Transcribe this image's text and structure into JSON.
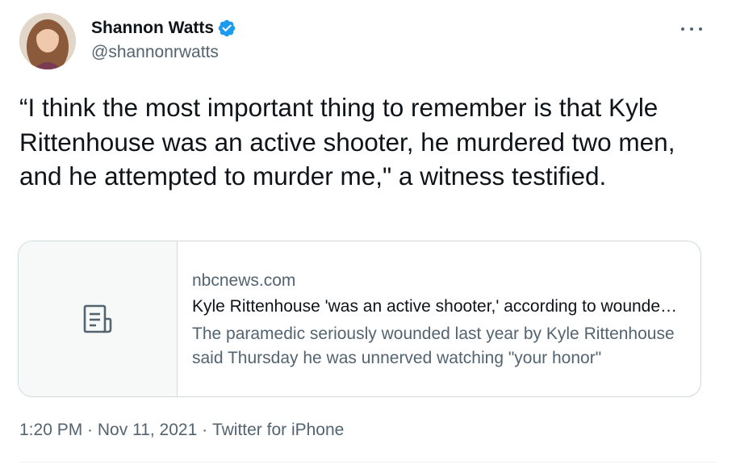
{
  "author": {
    "display_name": "Shannon Watts",
    "handle": "@shannonrwatts",
    "verified": true,
    "verified_color": "#1d9bf0"
  },
  "tweet": {
    "text": "“I think the most important thing to remember is that Kyle Rittenhouse was an active shooter, he murdered two men, and he attempted to murder me,\" a witness testified."
  },
  "card": {
    "icon": "article-icon",
    "domain": "nbcnews.com",
    "title": "Kyle Rittenhouse 'was an active shooter,' according to wounded paramedic",
    "description": "The paramedic seriously wounded last year by Kyle Rittenhouse said Thursday he was unnerved watching \"your honor\""
  },
  "meta": {
    "time": "1:20 PM",
    "separator": " · ",
    "date": "Nov 11, 2021",
    "source": "Twitter for iPhone"
  },
  "icons": {
    "more": "more-options-icon",
    "verified": "verified-badge-icon"
  }
}
